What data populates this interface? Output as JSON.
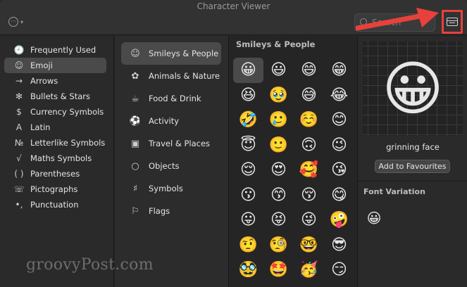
{
  "window": {
    "title": "Character Viewer"
  },
  "search": {
    "placeholder": "Search"
  },
  "sidebar": {
    "items": [
      {
        "label": "Frequently Used",
        "glyph": "🕘",
        "icon": "clock-icon"
      },
      {
        "label": "Emoji",
        "glyph": "☺",
        "icon": "smiley-icon",
        "active": true
      },
      {
        "label": "Arrows",
        "glyph": "→",
        "icon": "arrow-icon"
      },
      {
        "label": "Bullets & Stars",
        "glyph": "✻",
        "icon": "asterisk-icon"
      },
      {
        "label": "Currency Symbols",
        "glyph": "$",
        "icon": "dollar-icon"
      },
      {
        "label": "Latin",
        "glyph": "A",
        "icon": "latin-a-icon"
      },
      {
        "label": "Letterlike Symbols",
        "glyph": "№",
        "icon": "numero-icon"
      },
      {
        "label": "Maths Symbols",
        "glyph": "√",
        "icon": "square-root-icon"
      },
      {
        "label": "Parentheses",
        "glyph": "( )",
        "icon": "parentheses-icon"
      },
      {
        "label": "Pictographs",
        "glyph": "☏",
        "icon": "pictograph-icon"
      },
      {
        "label": "Punctuation",
        "glyph": "•,",
        "icon": "punctuation-icon"
      }
    ]
  },
  "categories": {
    "items": [
      {
        "label": "Smileys & People",
        "glyph": "☺",
        "icon": "smiley-icon",
        "active": true
      },
      {
        "label": "Animals & Nature",
        "glyph": "✿",
        "icon": "flower-icon"
      },
      {
        "label": "Food & Drink",
        "glyph": "☕",
        "icon": "cup-icon"
      },
      {
        "label": "Activity",
        "glyph": "⚽",
        "icon": "ball-icon"
      },
      {
        "label": "Travel & Places",
        "glyph": "▣",
        "icon": "bus-icon"
      },
      {
        "label": "Objects",
        "glyph": "○",
        "icon": "lightbulb-icon"
      },
      {
        "label": "Symbols",
        "glyph": "♯",
        "icon": "symbols-icon"
      },
      {
        "label": "Flags",
        "glyph": "⚐",
        "icon": "flag-icon"
      }
    ]
  },
  "emoji_grid": {
    "title": "Smileys & People",
    "items": [
      "😀",
      "😃",
      "😄",
      "😁",
      "😆",
      "🥹",
      "😅",
      "😂",
      "🤣",
      "🥲",
      "☺️",
      "😊",
      "😇",
      "🙂",
      "🙃",
      "😉",
      "😌",
      "😍",
      "🥰",
      "😘",
      "😗",
      "😙",
      "😚",
      "😋",
      "😛",
      "😝",
      "😜",
      "🤪",
      "🤨",
      "🧐",
      "🤓",
      "😎",
      "🥸",
      "🤩",
      "🥳",
      "😏"
    ],
    "selected_index": 0
  },
  "detail": {
    "preview": "😀",
    "name": "grinning face",
    "add_favourites_label": "Add to Favourites",
    "font_variation_title": "Font Variation",
    "font_variation_items": [
      "😀"
    ]
  },
  "watermark": "groovyPost.com",
  "colors": {
    "highlight": "#e8413b",
    "selection": "#4a4a4a"
  }
}
